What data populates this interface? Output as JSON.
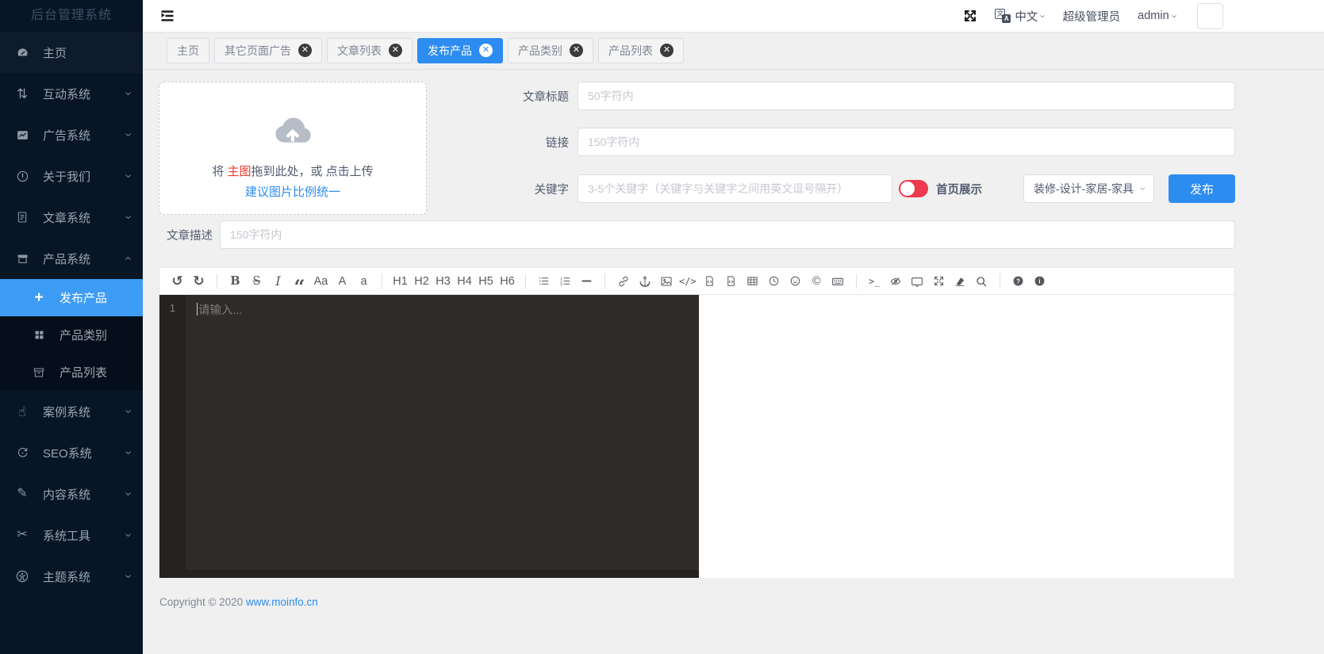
{
  "app": {
    "title": "后台管理系统"
  },
  "colors": {
    "primary": "#2d8cf0",
    "sidebar_bg": "#071525",
    "sidebar_active": "#3d9cf5",
    "toggle_on": "#ef394e",
    "upload_em_red": "#ed3b2f",
    "link_blue": "#2d8cf0"
  },
  "sidebar": {
    "items": [
      {
        "key": "home",
        "label": "主页",
        "icon": "dashboard",
        "tinted": true
      },
      {
        "key": "interaction",
        "label": "互动系统",
        "icon": "sort",
        "chevron": "down"
      },
      {
        "key": "ads",
        "label": "广告系统",
        "icon": "chart",
        "chevron": "down"
      },
      {
        "key": "about",
        "label": "关于我们",
        "icon": "warning",
        "chevron": "down"
      },
      {
        "key": "article",
        "label": "文章系统",
        "icon": "document",
        "chevron": "down"
      },
      {
        "key": "product",
        "label": "产品系统",
        "icon": "shop",
        "chevron": "up"
      },
      {
        "key": "publish-product",
        "label": "发布产品",
        "icon": "plus",
        "sub": true,
        "active": true
      },
      {
        "key": "product-category",
        "label": "产品类别",
        "icon": "grid",
        "sub": true
      },
      {
        "key": "product-list",
        "label": "产品列表",
        "icon": "archive",
        "sub": true
      },
      {
        "key": "case",
        "label": "案例系统",
        "icon": "hand",
        "chevron": "down"
      },
      {
        "key": "seo",
        "label": "SEO系统",
        "icon": "seo",
        "chevron": "down"
      },
      {
        "key": "content",
        "label": "内容系统",
        "icon": "pen",
        "chevron": "down"
      },
      {
        "key": "tools",
        "label": "系统工具",
        "icon": "scissors",
        "chevron": "down"
      },
      {
        "key": "theme",
        "label": "主题系统",
        "icon": "theme",
        "chevron": "down"
      }
    ]
  },
  "header": {
    "language": "中文",
    "role": "超级管理员",
    "username": "admin"
  },
  "tabs": [
    {
      "key": "home",
      "label": "主页",
      "closable": false,
      "active": false
    },
    {
      "key": "other-page-ad",
      "label": "其它页面广告",
      "closable": true,
      "active": false
    },
    {
      "key": "article-list",
      "label": "文章列表",
      "closable": true,
      "active": false
    },
    {
      "key": "publish-product",
      "label": "发布产品",
      "closable": true,
      "active": true
    },
    {
      "key": "product-category",
      "label": "产品类别",
      "closable": true,
      "active": false
    },
    {
      "key": "product-list",
      "label": "产品列表",
      "closable": true,
      "active": false
    }
  ],
  "form": {
    "upload": {
      "line1_prefix": "将 ",
      "line1_em": "主图",
      "line1_suffix": "拖到此处，或 点击上传",
      "line2": "建议图片比例统一"
    },
    "title_label": "文章标题",
    "title_placeholder": "50字符内",
    "link_label": "链接",
    "link_placeholder": "150字符内",
    "keywords_label": "关键字",
    "keywords_placeholder": "3-5个关键字（关键字与关键字之间用英文逗号隔开）",
    "home_show_label": "首页展示",
    "category_value": "装修-设计-家居-家具",
    "publish_label": "发布",
    "desc_label": "文章描述",
    "desc_placeholder": "150字符内"
  },
  "editor": {
    "line_number": "1",
    "placeholder": "请输入..."
  },
  "editor_toolbar": [
    {
      "name": "undo-icon",
      "icon": "undo"
    },
    {
      "name": "redo-icon",
      "icon": "redo"
    },
    {
      "div": true
    },
    {
      "name": "bold-button",
      "text": "B",
      "cls": "t-bold"
    },
    {
      "name": "strikethrough-button",
      "text": "S",
      "cls": "t-strike"
    },
    {
      "name": "italic-button",
      "text": "I",
      "cls": "t-italic"
    },
    {
      "name": "quote-icon",
      "icon": "quote"
    },
    {
      "name": "font-size-button",
      "text": "Aa"
    },
    {
      "name": "uppercase-button",
      "text": "A"
    },
    {
      "name": "lowercase-button",
      "text": "a"
    },
    {
      "div": true
    },
    {
      "name": "heading-1-button",
      "text": "H1"
    },
    {
      "name": "heading-2-button",
      "text": "H2"
    },
    {
      "name": "heading-3-button",
      "text": "H3"
    },
    {
      "name": "heading-4-button",
      "text": "H4"
    },
    {
      "name": "heading-5-button",
      "text": "H5"
    },
    {
      "name": "heading-6-button",
      "text": "H6"
    },
    {
      "div": true
    },
    {
      "name": "list-ul-icon",
      "icon": "list-ul"
    },
    {
      "name": "list-ol-icon",
      "icon": "list-ol"
    },
    {
      "name": "hr-icon",
      "icon": "hr"
    },
    {
      "div": true
    },
    {
      "name": "link-icon",
      "icon": "link"
    },
    {
      "name": "anchor-icon",
      "icon": "anchor"
    },
    {
      "name": "image-icon",
      "icon": "image"
    },
    {
      "name": "code-inline-button",
      "text": "</>",
      "cls": "t-code"
    },
    {
      "name": "code-block-icon",
      "icon": "file-code"
    },
    {
      "name": "html-block-icon",
      "icon": "file-code"
    },
    {
      "name": "table-icon",
      "icon": "table"
    },
    {
      "name": "datetime-icon",
      "icon": "clock"
    },
    {
      "name": "emoji-icon",
      "icon": "smiley"
    },
    {
      "name": "copyright-button",
      "text": "©"
    },
    {
      "name": "keyboard-icon",
      "icon": "keyboard"
    },
    {
      "div": true
    },
    {
      "name": "terminal-button",
      "text": ">_",
      "cls": "t-code"
    },
    {
      "name": "preview-off-icon",
      "icon": "eye-off"
    },
    {
      "name": "browser-preview-icon",
      "icon": "browser"
    },
    {
      "name": "fullscreen-icon",
      "icon": "expand"
    },
    {
      "name": "clear-icon",
      "icon": "eraser"
    },
    {
      "name": "search-icon",
      "icon": "search"
    },
    {
      "div": true
    },
    {
      "name": "help-icon",
      "icon": "help"
    },
    {
      "name": "info-icon",
      "icon": "info"
    }
  ],
  "footer": {
    "copyright": "Copyright © 2020 ",
    "link": "www.moinfo.cn"
  }
}
